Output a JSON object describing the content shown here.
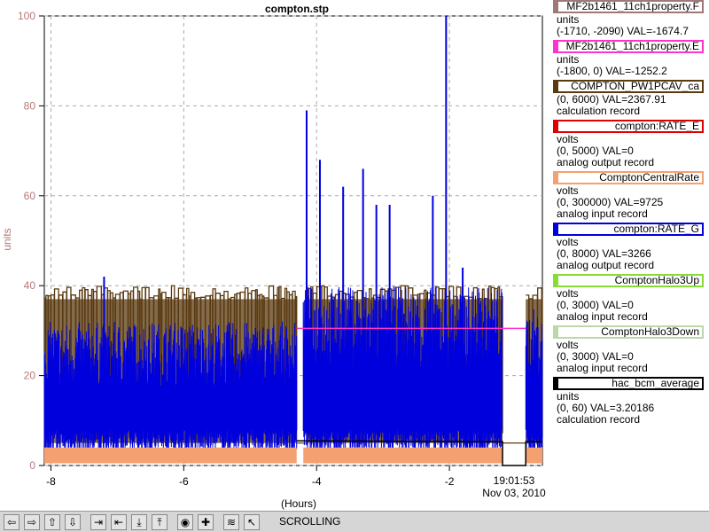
{
  "chart_data": {
    "type": "line",
    "title": "compton.stp",
    "xlabel": "(Hours)",
    "ylabel": "units",
    "xlim": [
      -8.1,
      -0.6
    ],
    "ylim": [
      0,
      100
    ],
    "x_ticks": [
      -8,
      -6,
      -4,
      -2
    ],
    "x_tick_labels": [
      "-8",
      "-6",
      "-4",
      "-2"
    ],
    "y_ticks": [
      0,
      20,
      40,
      60,
      80,
      100
    ],
    "y_tick_labels": [
      "0",
      "20",
      "40",
      "60",
      "80",
      "100"
    ],
    "end_time_label": "19:01:53",
    "end_date_label": "Nov 03, 2010",
    "grid": true,
    "legend_position": "right",
    "series": [
      {
        "name": "COMPTON_PW1PCAV_ca",
        "color": "#5a3a10",
        "kind": "square-wave",
        "segments": [
          [
            -8.1,
            -4.3,
            40
          ],
          [
            -4.3,
            -4.15,
            0
          ],
          [
            -4.15,
            -1.2,
            40
          ],
          [
            -1.2,
            -0.85,
            0
          ],
          [
            -0.85,
            -0.6,
            40
          ]
        ],
        "low": 5
      },
      {
        "name": "compton:RATE_G",
        "color": "#0000dd",
        "kind": "noisy",
        "segments": [
          [
            -8.1,
            -4.3,
            32
          ],
          [
            -4.2,
            -1.2,
            40
          ],
          [
            -0.85,
            -0.6,
            35
          ]
        ],
        "peaks": [
          [
            -7.2,
            42
          ],
          [
            -4.15,
            79
          ],
          [
            -3.95,
            68
          ],
          [
            -3.6,
            62
          ],
          [
            -3.3,
            66
          ],
          [
            -3.1,
            58
          ],
          [
            -2.9,
            58
          ],
          [
            -2.25,
            60
          ],
          [
            -2.05,
            100
          ],
          [
            -1.8,
            44
          ]
        ]
      },
      {
        "name": "ComptonCentralRate",
        "color": "#f4a070",
        "kind": "band",
        "segments": [
          [
            -8.1,
            -4.3,
            4
          ],
          [
            -4.2,
            -1.2,
            4
          ],
          [
            -0.85,
            -0.6,
            4
          ]
        ]
      },
      {
        "name": "MF2b1461_11ch1property.E",
        "color": "#ff33cc",
        "kind": "step",
        "points": [
          [
            -4.3,
            30.5
          ],
          [
            -1.2,
            30.5
          ],
          [
            -0.85,
            30.5
          ]
        ]
      },
      {
        "name": "hac_bcm_average",
        "color": "#000000",
        "kind": "step",
        "points": [
          [
            -4.3,
            5.5
          ],
          [
            -1.5,
            5.3
          ],
          [
            -1.2,
            5.3
          ],
          [
            -1.2,
            0
          ],
          [
            -0.85,
            0
          ],
          [
            -0.85,
            5.3
          ],
          [
            -0.6,
            5.3
          ]
        ]
      }
    ]
  },
  "legend": [
    {
      "name": "MF2b1461_11ch1property.F",
      "color": "#a07878",
      "lines": [
        "units",
        "(-1710, -2090) VAL=-1674.7"
      ]
    },
    {
      "name": "MF2b1461_11ch1property.E",
      "color": "#ff33cc",
      "lines": [
        "units",
        "(-1800, 0) VAL=-1252.2"
      ]
    },
    {
      "name": "COMPTON_PW1PCAV_ca",
      "color": "#5a3a10",
      "lines": [
        "(0, 6000) VAL=2367.91",
        "calculation record"
      ]
    },
    {
      "name": "compton:RATE_E",
      "color": "#dd0000",
      "lines": [
        "volts",
        "(0, 5000) VAL=0",
        "analog output record"
      ]
    },
    {
      "name": "ComptonCentralRate",
      "color": "#f4a070",
      "lines": [
        "volts",
        "(0, 300000) VAL=9725",
        "analog input record"
      ]
    },
    {
      "name": "compton:RATE_G",
      "color": "#0000dd",
      "lines": [
        "volts",
        "(0, 8000) VAL=3266",
        "analog output record"
      ]
    },
    {
      "name": "ComptonHalo3Up",
      "color": "#88dd33",
      "lines": [
        "volts",
        "(0, 3000) VAL=0",
        "analog input record"
      ]
    },
    {
      "name": "ComptonHalo3Down",
      "color": "#bbd8a8",
      "lines": [
        "volts",
        "(0, 3000) VAL=0",
        "analog input record"
      ]
    },
    {
      "name": "hac_bcm_average",
      "color": "#000000",
      "lines": [
        "units",
        "(0, 60) VAL=3.20186",
        "calculation record"
      ]
    }
  ],
  "toolbar": {
    "status": "SCROLLING",
    "buttons": [
      {
        "name": "pan-left-button",
        "glyph": "⇦"
      },
      {
        "name": "pan-right-button",
        "glyph": "⇨"
      },
      {
        "name": "pan-up-button",
        "glyph": "⇧"
      },
      {
        "name": "pan-down-button",
        "glyph": "⇩"
      },
      {
        "name": "zoom-in-horizontal-button",
        "glyph": "⇥"
      },
      {
        "name": "zoom-out-horizontal-button",
        "glyph": "⇤"
      },
      {
        "name": "zoom-in-vertical-button",
        "glyph": "⤓"
      },
      {
        "name": "zoom-out-vertical-button",
        "glyph": "⤒"
      },
      {
        "name": "auto-scale-button",
        "glyph": "◉"
      },
      {
        "name": "crosshair-button",
        "glyph": "✚"
      },
      {
        "name": "stagger-button",
        "glyph": "≋"
      },
      {
        "name": "pointer-button",
        "glyph": "↖"
      }
    ]
  }
}
